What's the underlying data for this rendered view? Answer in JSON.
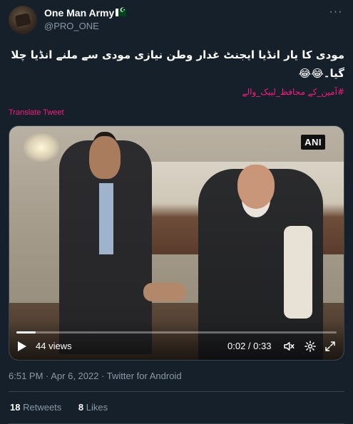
{
  "author": {
    "display_name": "One Man Army",
    "handle": "@PRO_ONE",
    "flag_icon": "pakistan-flag-icon"
  },
  "tweet": {
    "text": "مودی کا یار انڈیا ایجنٹ غدار وطن نیازی مودی سے ملنے انڈیا چلا گیا۔😂😂",
    "hashtag": "#آمین_کے محافظ_لبیک_والے",
    "translate_label": "Translate Tweet"
  },
  "video": {
    "watermark": "ANI",
    "views": "44 views",
    "time": "0:02 / 0:33",
    "progress": 0.06
  },
  "meta": {
    "timestamp": "6:51 PM · Apr 6, 2022 · Twitter for Android"
  },
  "stats": {
    "retweets_count": "18",
    "retweets_label": "Retweets",
    "likes_count": "8",
    "likes_label": "Likes"
  },
  "colors": {
    "background": "#15202b",
    "secondary_text": "#8b98a5",
    "accent_pink": "#f91880",
    "divider": "#38444d"
  }
}
